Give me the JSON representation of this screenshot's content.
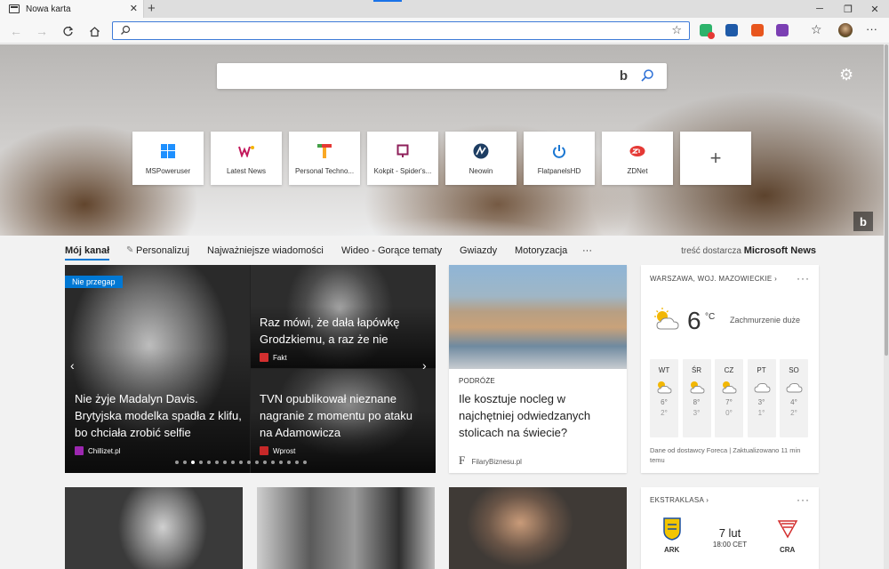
{
  "browser": {
    "tab_title": "Nowa karta",
    "tab_close": "✕",
    "new_tab": "+",
    "minimize": "─",
    "restore": "❐",
    "close": "✕",
    "address_placeholder": "",
    "icons": [
      "back-icon",
      "forward-icon",
      "refresh-icon",
      "home-icon",
      "search-icon",
      "favorite-star-icon",
      "favorites-icon",
      "profile-avatar"
    ]
  },
  "hero": {
    "search_placeholder": "",
    "bing_logo": "b",
    "corner_logo": "b",
    "tiles": [
      {
        "label": "MSPoweruser",
        "icon": "windows-logo-icon"
      },
      {
        "label": "Latest News",
        "icon": "latest-news-logo-icon"
      },
      {
        "label": "Personal Techno...",
        "icon": "personal-tech-logo-icon"
      },
      {
        "label": "Kokpit - Spider's...",
        "icon": "spiders-web-logo-icon"
      },
      {
        "label": "Neowin",
        "icon": "neowin-logo-icon"
      },
      {
        "label": "FlatpanelsHD",
        "icon": "power-logo-icon"
      },
      {
        "label": "ZDNet",
        "icon": "zdnet-logo-icon"
      }
    ],
    "add_tile": "+"
  },
  "categories": {
    "items": [
      "Mój kanał",
      "Personalizuj",
      "Najważniejsze wiadomości",
      "Wideo - Gorące tematy",
      "Gwiazdy",
      "Motoryzacja"
    ],
    "more": "···",
    "provider_prefix": "treść dostarcza",
    "provider_name": "Microsoft News"
  },
  "carousel": {
    "badge": "Nie przegap",
    "main_title": "Nie żyje Madalyn Davis. Brytyjska modelka spadła z klifu, bo chciała zrobić selfie",
    "main_source": "Chillizet.pl",
    "top_title": "Raz mówi, że dała łapówkę Grodzkiemu, a raz że nie",
    "top_source": "Fakt",
    "bottom_title": "TVN opublikował nieznane nagranie z momentu po ataku na Adamowicza",
    "bottom_source": "Wprost",
    "prev": "‹",
    "next": "›",
    "dot_count": 17,
    "active_dot": 2
  },
  "article": {
    "tag": "PODRÓŻE",
    "title": "Ile kosztuje nocleg w najchętniej odwiedzanych stolicach na świecie?",
    "source_letter": "F",
    "source": "FilaryBiznesu.pl"
  },
  "weather": {
    "location": "WARSZAWA, WOJ. MAZOWIECKIE",
    "chevron": "›",
    "more": "···",
    "temp": "6",
    "unit": "°C",
    "condition": "Zachmurzenie duże",
    "forecast": [
      {
        "day": "WT",
        "hi": "6°",
        "lo": "2°",
        "icon": "partly-sunny-icon"
      },
      {
        "day": "ŚR",
        "hi": "8°",
        "lo": "3°",
        "icon": "partly-sunny-icon"
      },
      {
        "day": "CZ",
        "hi": "7°",
        "lo": "0°",
        "icon": "partly-sunny-icon"
      },
      {
        "day": "PT",
        "hi": "3°",
        "lo": "1°",
        "icon": "cloudy-icon"
      },
      {
        "day": "SO",
        "hi": "4°",
        "lo": "2°",
        "icon": "cloudy-icon"
      }
    ],
    "footer": "Dane od dostawcy Foreca | Zaktualizowano 11 min temu"
  },
  "sport": {
    "league": "EKSTRAKLASA",
    "chevron": "›",
    "more": "···",
    "date": "7 lut",
    "time": "18:00 CET",
    "home": "ARK",
    "away": "CRA"
  },
  "colors": {
    "accent": "#0078d4",
    "address_border": "#3e7bd8"
  }
}
